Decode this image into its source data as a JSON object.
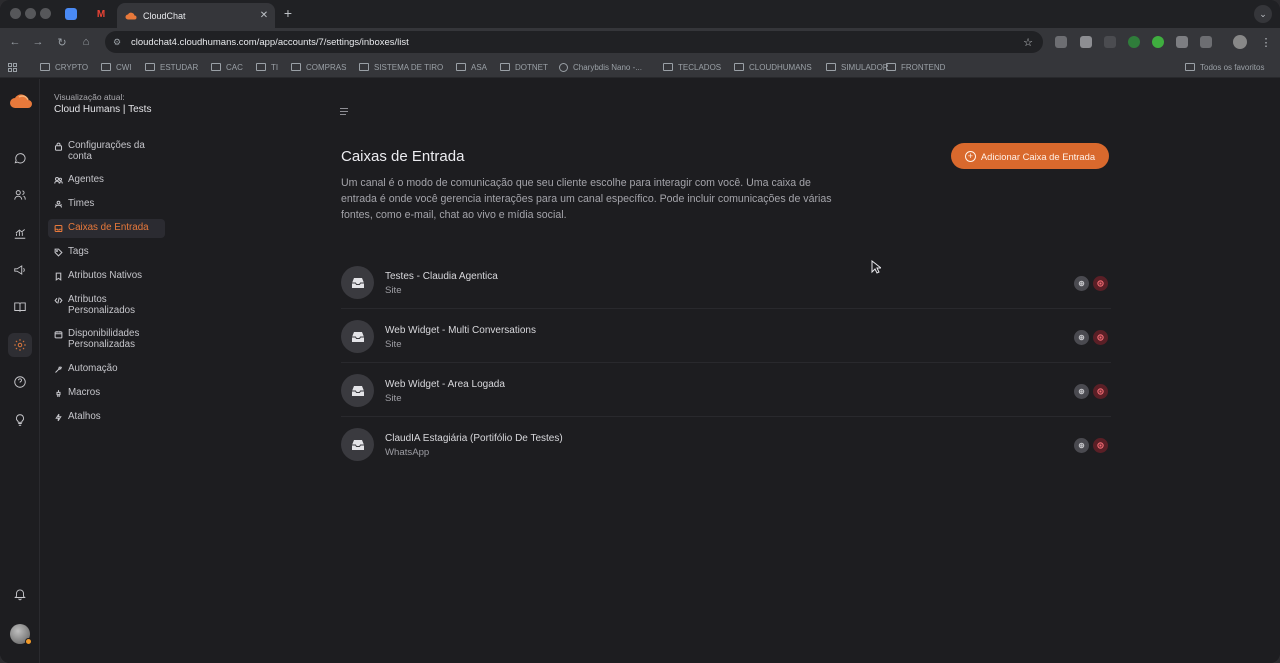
{
  "browser": {
    "tab_title": "CloudChat",
    "url": "cloudchat4.cloudhumans.com/app/accounts/7/settings/inboxes/list",
    "bookmarks": [
      {
        "label": "CRYPTO",
        "type": "folder"
      },
      {
        "label": "CWI",
        "type": "folder"
      },
      {
        "label": "ESTUDAR",
        "type": "folder"
      },
      {
        "label": "CAC",
        "type": "folder"
      },
      {
        "label": "TI",
        "type": "folder"
      },
      {
        "label": "COMPRAS",
        "type": "folder"
      },
      {
        "label": "SISTEMA DE TIRO",
        "type": "folder"
      },
      {
        "label": "ASA",
        "type": "folder"
      },
      {
        "label": "DOTNET",
        "type": "folder"
      },
      {
        "label": "Charybdis Nano -...",
        "type": "link"
      },
      {
        "label": "TECLADOS",
        "type": "folder"
      },
      {
        "label": "CLOUDHUMANS",
        "type": "folder"
      },
      {
        "label": "SIMULADOR",
        "type": "folder"
      },
      {
        "label": "FRONTEND",
        "type": "folder"
      }
    ],
    "all_bookmarks": "Todos os favoritos"
  },
  "sidebar": {
    "view_label": "Visualização atual:",
    "view_name": "Cloud Humans | Tests",
    "items": [
      {
        "label": "Configurações da conta",
        "icon": "lock-icon"
      },
      {
        "label": "Agentes",
        "icon": "people-icon"
      },
      {
        "label": "Times",
        "icon": "team-icon"
      },
      {
        "label": "Caixas de Entrada",
        "icon": "inbox-icon",
        "active": true
      },
      {
        "label": "Tags",
        "icon": "tag-icon"
      },
      {
        "label": "Atributos Nativos",
        "icon": "bookmark-icon"
      },
      {
        "label": "Atributos Personalizados",
        "icon": "code-icon"
      },
      {
        "label": "Disponibilidades Personalizadas",
        "icon": "calendar-icon"
      },
      {
        "label": "Automação",
        "icon": "automation-icon"
      },
      {
        "label": "Macros",
        "icon": "macro-icon"
      },
      {
        "label": "Atalhos",
        "icon": "shortcut-icon"
      }
    ]
  },
  "main": {
    "title": "Caixas de Entrada",
    "description": "Um canal é o modo de comunicação que seu cliente escolhe para interagir com você. Uma caixa de entrada é onde você gerencia interações para um canal específico. Pode incluir comunicações de várias fontes, como e-mail, chat ao vivo e mídia social.",
    "add_button": "Adicionar Caixa de Entrada",
    "inboxes": [
      {
        "name": "Testes - Claudia Agentica",
        "channel": "Site"
      },
      {
        "name": "Web Widget - Multi Conversations",
        "channel": "Site"
      },
      {
        "name": "Web Widget - Area Logada",
        "channel": "Site"
      },
      {
        "name": "ClaudIA Estagiária (Portifólio De Testes)",
        "channel": "WhatsApp"
      }
    ]
  },
  "colors": {
    "accent": "#d9692d",
    "background": "#1d1d20",
    "delete": "#5a1f26"
  }
}
